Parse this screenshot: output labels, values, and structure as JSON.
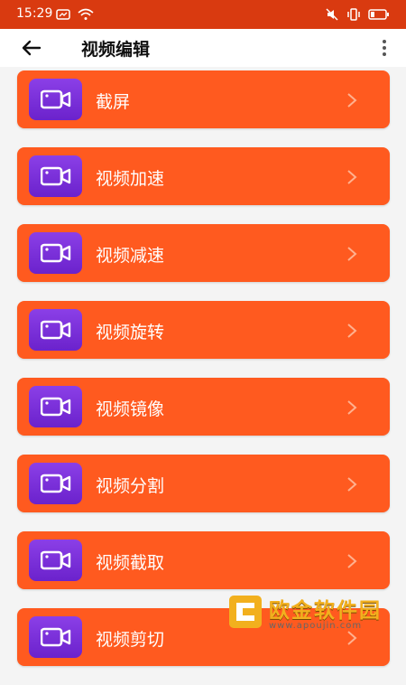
{
  "status": {
    "time": "15:29"
  },
  "header": {
    "title": "视频编辑"
  },
  "items": [
    {
      "label": "截屏"
    },
    {
      "label": "视频加速"
    },
    {
      "label": "视频减速"
    },
    {
      "label": "视频旋转"
    },
    {
      "label": "视频镜像"
    },
    {
      "label": "视频分割"
    },
    {
      "label": "视频截取"
    },
    {
      "label": "视频剪切"
    }
  ],
  "watermark": {
    "name": "欧金软件园",
    "url": "www.apoujin.com"
  },
  "colors": {
    "statusbar": "#d93a10",
    "item_bg": "#ff5a1f",
    "icon_bg": "#7b2fe0"
  }
}
